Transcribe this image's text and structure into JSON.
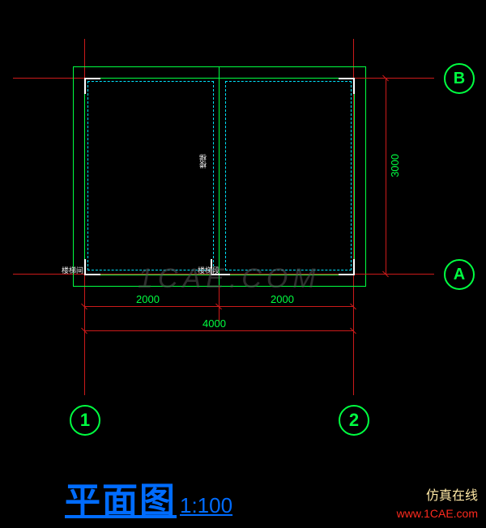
{
  "title": {
    "text": "平面图",
    "ratio": "1:100"
  },
  "axes": {
    "letters": [
      "A",
      "B"
    ],
    "numbers": [
      "1",
      "2"
    ]
  },
  "dimensions": {
    "span_left": "2000",
    "span_right": "2000",
    "total": "4000",
    "height": "3000"
  },
  "room_labels": {
    "mid_vertical": "楼梯",
    "bottom_left": "楼梯间",
    "bottom_mid": "楼梯段"
  },
  "watermark": {
    "center": "1CAE.COM",
    "brand_cn": "仿真在线",
    "brand_url": "www.1CAE.com"
  }
}
